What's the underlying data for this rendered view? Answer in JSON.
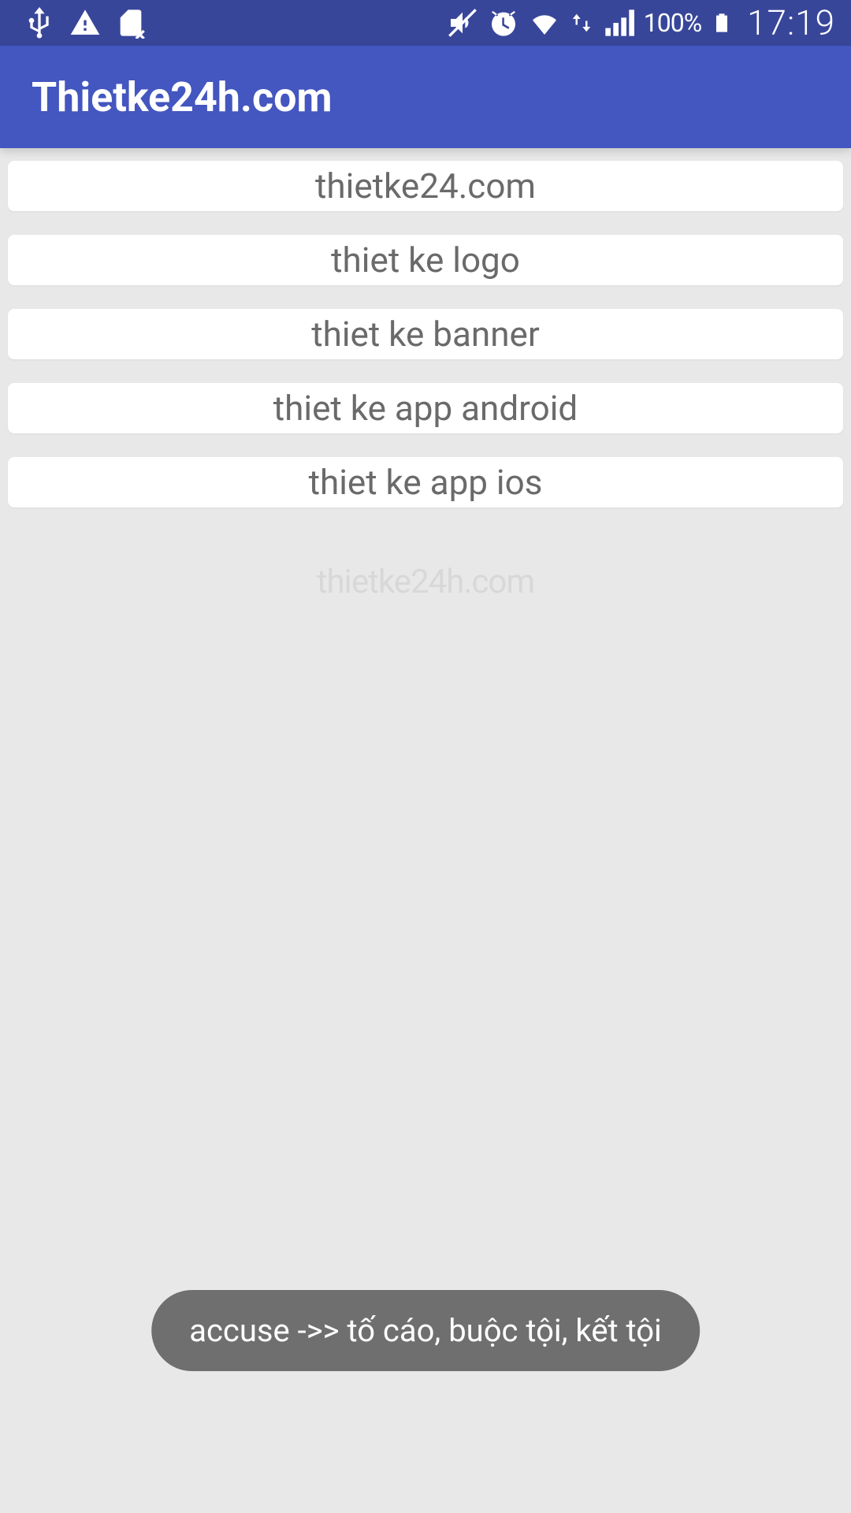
{
  "status": {
    "battery_text": "100%",
    "clock": "17:19"
  },
  "app": {
    "title": "Thietke24h.com"
  },
  "list": {
    "items": [
      "thietke24.com",
      "thiet ke logo",
      "thiet ke banner",
      "thiet ke app android",
      "thiet ke app ios"
    ]
  },
  "watermark": "thietke24h.com",
  "toast": "accuse ->> tố cáo, buộc tội, kết tội"
}
